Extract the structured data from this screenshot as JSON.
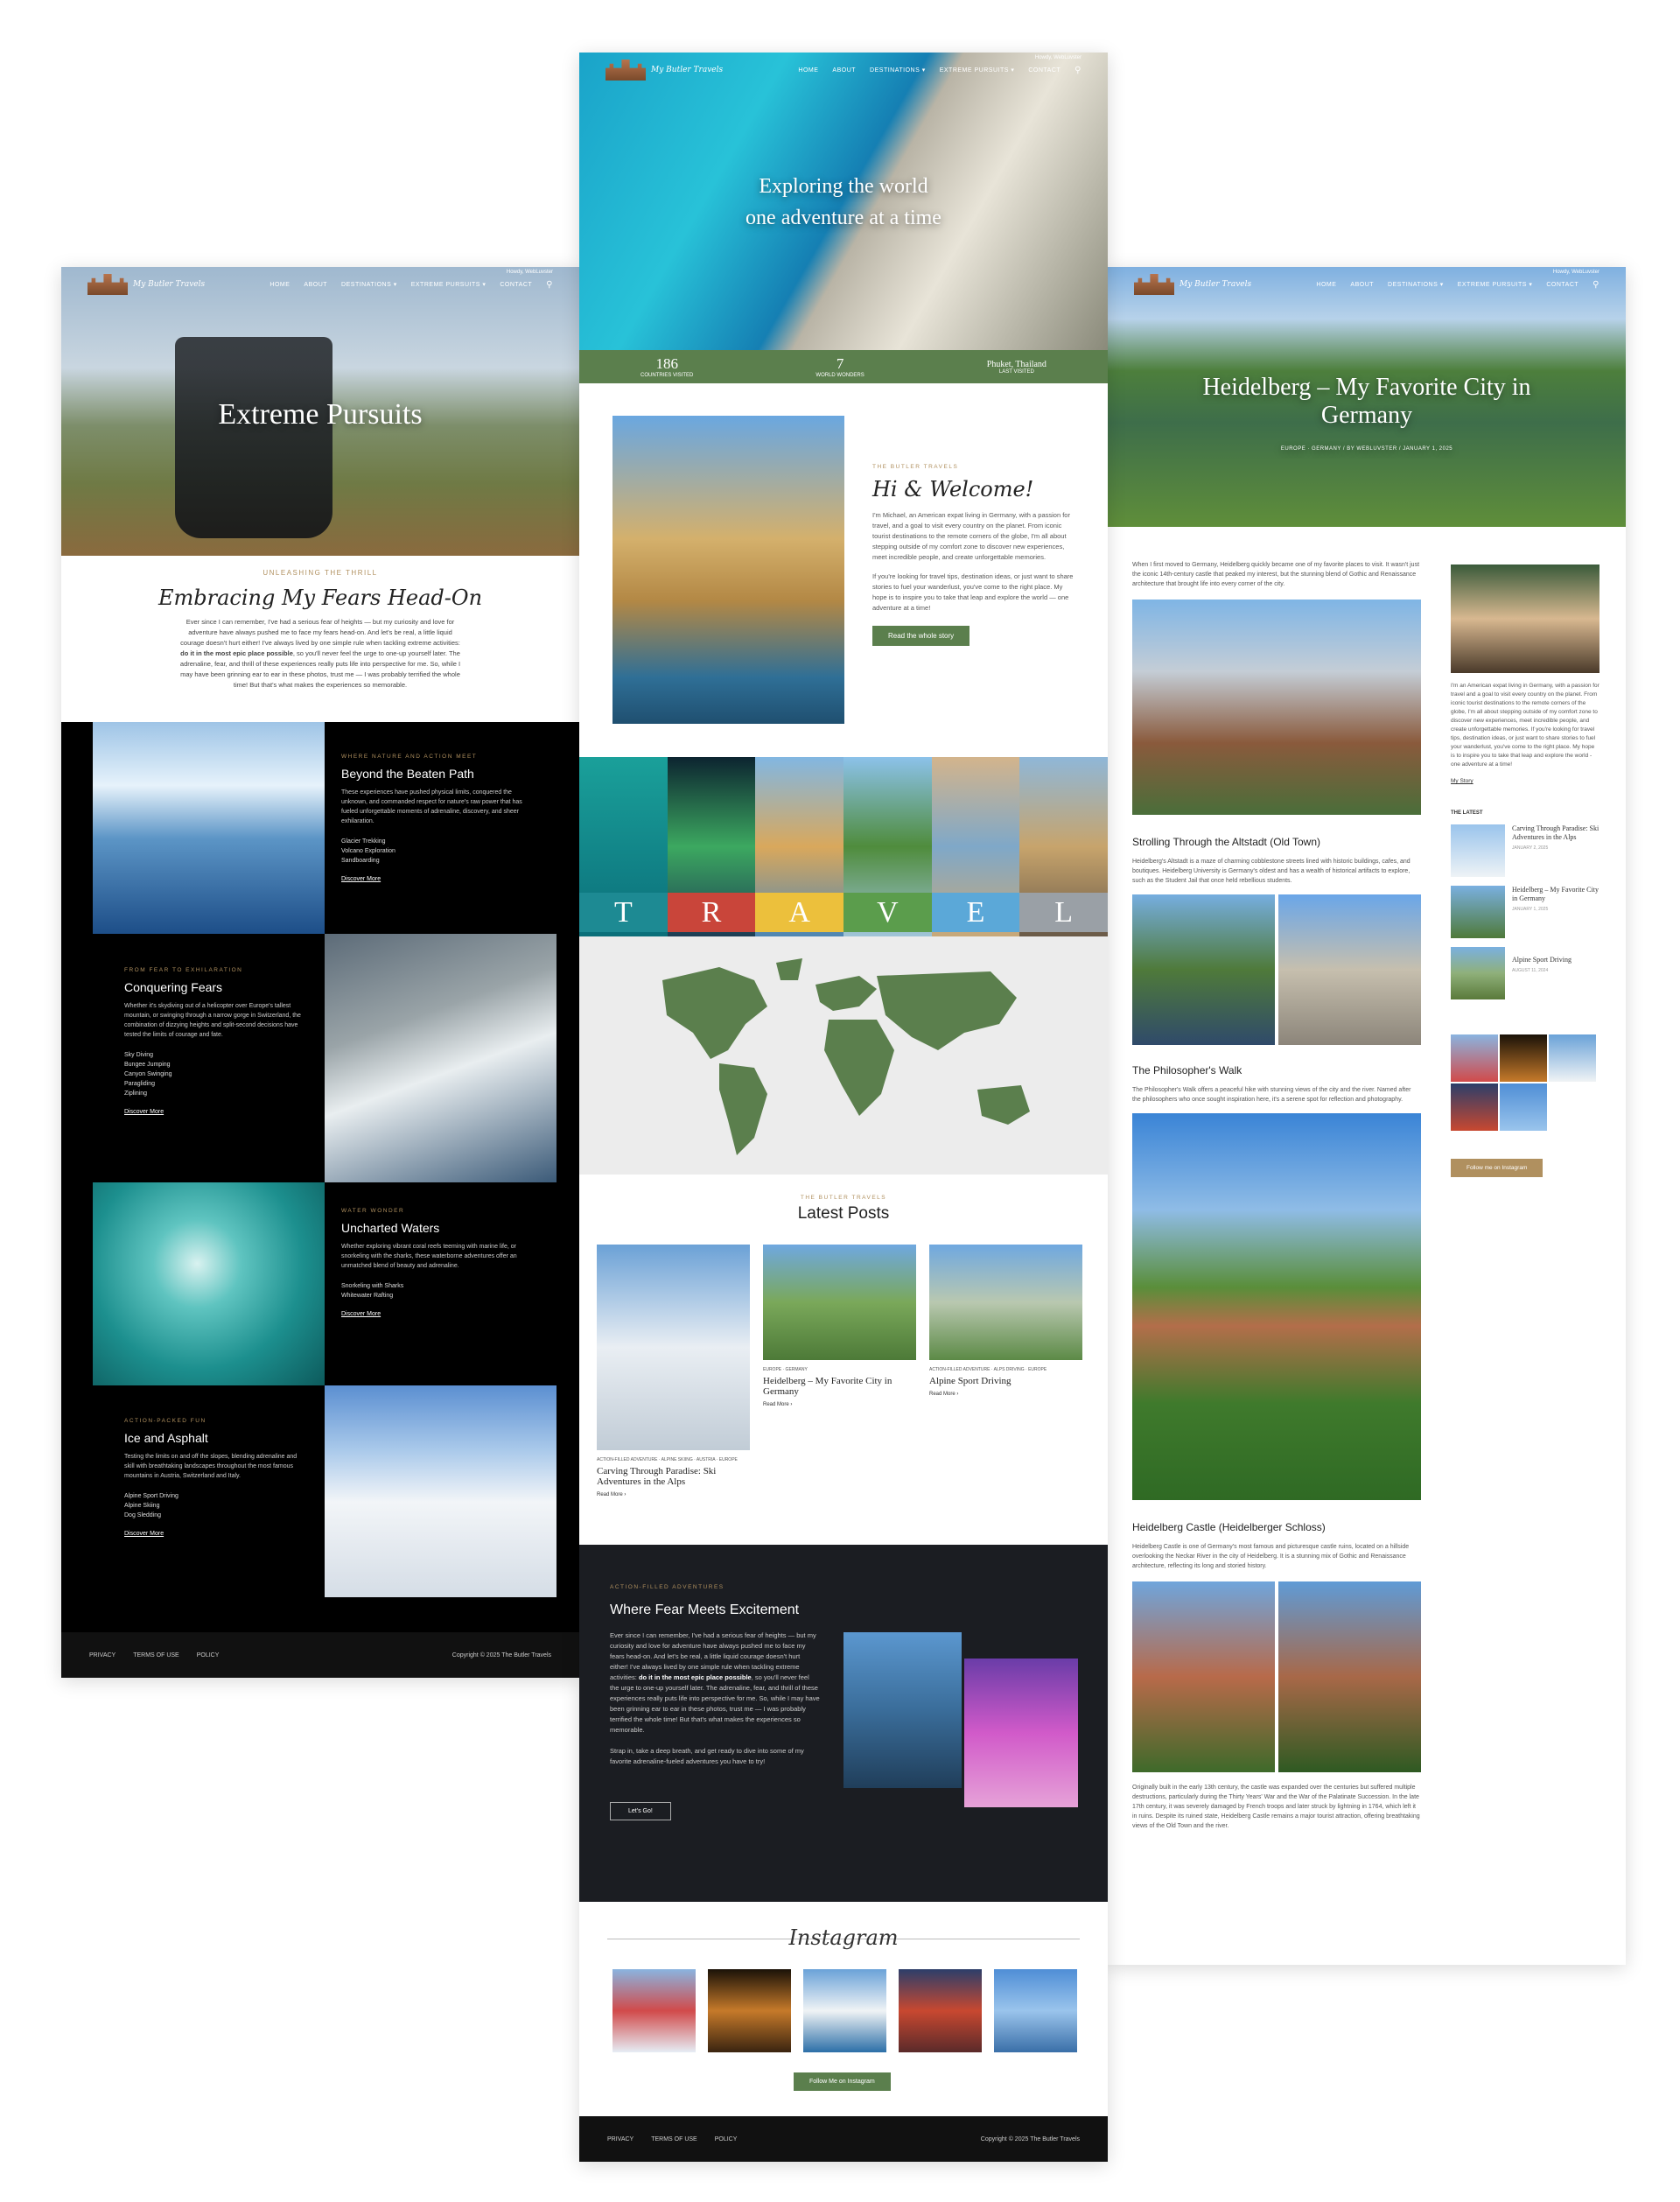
{
  "nav": {
    "logo": "My Butler Travels",
    "items": [
      "HOME",
      "ABOUT",
      "DESTINATIONS ▾",
      "EXTREME PURSUITS ▾",
      "CONTACT"
    ],
    "topnote": "Howdy, WebLuvster"
  },
  "icons": {
    "search": "search-icon"
  },
  "home": {
    "hero_line1": "Exploring the world",
    "hero_line2": "one adventure at a time",
    "stats": [
      {
        "value": "186",
        "label": "COUNTRIES VISITED"
      },
      {
        "value": "7",
        "label": "WORLD WONDERS"
      },
      {
        "value": "Phuket, Thailand",
        "label": "LAST VISITED"
      }
    ],
    "welcome_eyebrow": "THE BUTLER TRAVELS",
    "welcome_title": "Hi & Welcome!",
    "welcome_p1": "I'm Michael, an American expat living in Germany, with a passion for travel, and a goal to visit every country on the planet. From iconic tourist destinations to the remote corners of the globe, I'm all about stepping outside of my comfort zone to discover new experiences, meet incredible people, and create unforgettable memories.",
    "welcome_p2": "If you're looking for travel tips, destination ideas, or just want to share stories to fuel your wanderlust, you've come to the right place. My hope is to inspire you to take that leap and explore the world — one adventure at a time!",
    "welcome_btn": "Read the whole story",
    "travel_letters": [
      "T",
      "R",
      "A",
      "V",
      "E",
      "L"
    ],
    "latest_eyebrow": "THE BUTLER TRAVELS",
    "latest_title": "Latest Posts",
    "posts": [
      {
        "cats": "ACTION-FILLED ADVENTURE · ALPINE SKIING · AUSTRIA · EUROPE",
        "title": "Carving Through Paradise: Ski Adventures in the Alps",
        "more": "Read More ›"
      },
      {
        "cats": "EUROPE · GERMANY",
        "title": "Heidelberg – My Favorite City in Germany",
        "more": "Read More ›"
      },
      {
        "cats": "ACTION-FILLED ADVENTURE · ALPS DRIVING · EUROPE",
        "title": "Alpine Sport Driving",
        "more": "Read More ›"
      }
    ],
    "fear_eyebrow": "ACTION-FILLED ADVENTURES",
    "fear_title": "Where Fear Meets Excitement",
    "fear_p1a": "Ever since I can remember, I've had a serious fear of heights — but my curiosity and love for adventure have always pushed me to face my fears head-on. And let's be real, a little liquid courage doesn't hurt either! I've always lived by one simple rule when tackling extreme activities: ",
    "fear_p1b": "do it in the most epic place possible",
    "fear_p1c": ", so you'll never feel the urge to one-up yourself later. The adrenaline, fear, and thrill of these experiences really puts life into perspective for me. So, while I may have been grinning ear to ear in these photos, trust me — I was probably terrified the whole time! But that's what makes the experiences so memorable.",
    "fear_p2": "Strap in, take a deep breath, and get ready to dive into some of my favorite adrenaline-fueled adventures you have to try!",
    "fear_btn": "Let's Go!",
    "insta_title": "Instagram",
    "insta_btn": "Follow Me on Instagram"
  },
  "footer": {
    "links": [
      "PRIVACY",
      "TERMS OF USE",
      "POLICY"
    ],
    "copyright": "Copyright © 2025 The Butler Travels"
  },
  "extreme": {
    "hero_title": "Extreme Pursuits",
    "eyebrow": "UNLEASHING THE THRILL",
    "title": "Embracing My Fears Head-On",
    "intro_a": "Ever since I can remember, I've had a serious fear of heights — but my curiosity and love for adventure have always pushed me to face my fears head-on. And let's be real, a little liquid courage doesn't hurt either! I've always lived by one simple rule when tackling extreme activities: ",
    "intro_b": "do it in the most epic place possible",
    "intro_c": ", so you'll never feel the urge to one-up yourself later. The adrenaline, fear, and thrill of these experiences really puts life into perspective for me. So, while I may have been grinning ear to ear in these photos, trust me — I was probably terrified the whole time! But that's what makes the experiences so memorable.",
    "blocks": [
      {
        "eyebrow": "WHERE NATURE AND ACTION MEET",
        "title": "Beyond the Beaten Path",
        "text": "These experiences have pushed physical limits, conquered the unknown, and commanded respect for nature's raw power that has fueled unforgettable moments of adrenaline, discovery, and sheer exhilaration.",
        "list": [
          "Glacier Trekking",
          "Volcano Exploration",
          "Sandboarding"
        ],
        "more": "Discover More"
      },
      {
        "eyebrow": "FROM FEAR TO EXHILARATION",
        "title": "Conquering Fears",
        "text": "Whether it's skydiving out of a helicopter over Europe's tallest mountain, or swinging through a narrow gorge in Switzerland, the combination of dizzying heights and split-second decisions have tested the limits of courage and fate.",
        "list": [
          "Sky Diving",
          "Bungee Jumping",
          "Canyon Swinging",
          "Paragliding",
          "Ziplining"
        ],
        "more": "Discover More"
      },
      {
        "eyebrow": "WATER WONDER",
        "title": "Uncharted Waters",
        "text": "Whether exploring vibrant coral reefs teeming with marine life, or snorkeling with the sharks, these waterborne adventures offer an unmatched blend of beauty and adrenaline.",
        "list": [
          "Snorkeling with Sharks",
          "Whitewater Rafting"
        ],
        "more": "Discover More"
      },
      {
        "eyebrow": "ACTION-PACKED FUN",
        "title": "Ice and Asphalt",
        "text": "Testing the limits on and off the slopes, blending adrenaline and skill with breathtaking landscapes throughout the most famous mountains in Austria, Switzerland and Italy.",
        "list": [
          "Alpine Sport Driving",
          "Alpine Skiing",
          "Dog Sledding"
        ],
        "more": "Discover More"
      }
    ]
  },
  "heidelberg": {
    "hero_title": "Heidelberg – My Favorite City in Germany",
    "meta": "EUROPE · GERMANY / BY WEBLUVSTER / JANUARY 1, 2025",
    "intro": "When I first moved to Germany, Heidelberg quickly became one of my favorite places to visit. It wasn't just the iconic 14th-century castle that peaked my interest, but the stunning blend of Gothic and Renaissance architecture that brought life into every corner of the city.",
    "h1": "Strolling Through the Altstadt (Old Town)",
    "p1": "Heidelberg's Altstadt is a maze of charming cobblestone streets lined with historic buildings, cafes, and boutiques. Heidelberg University is Germany's oldest and has a wealth of historical artifacts to explore, such as the Student Jail that once held rebellious students.",
    "h2": "The Philosopher's Walk",
    "p2": "The Philosopher's Walk offers a peaceful hike with stunning views of the city and the river. Named after the philosophers who once sought inspiration here, it's a serene spot for reflection and photography.",
    "h3": "Heidelberg Castle (Heidelberger Schloss)",
    "p3": "Heidelberg Castle is one of Germany's most famous and picturesque castle ruins, located on a hillside overlooking the Neckar River in the city of Heidelberg. It is a stunning mix of Gothic and Renaissance architecture, reflecting its long and storied history.",
    "p4": "Originally built in the early 13th century, the castle was expanded over the centuries but suffered multiple destructions, particularly during the Thirty Years' War and the War of the Palatinate Succession. In the late 17th century, it was severely damaged by French troops and later struck by lightning in 1764, which left it in ruins. Despite its ruined state, Heidelberg Castle remains a major tourist attraction, offering breathtaking views of the Old Town and the river.",
    "side_bio": "I'm an American expat living in Germany, with a passion for travel and a goal to visit every country on the planet. From iconic tourist destinations to the remote corners of the globe, I'm all about stepping outside of my comfort zone to discover new experiences, meet incredible people, and create unforgettable memories. If you're looking for travel tips, destination ideas, or just want to share stories to fuel your wanderlust, you've come to the right place. My hope is to inspire you to take that leap and explore the world - one adventure at a time!",
    "side_story": "My Story",
    "side_latest": "THE LATEST",
    "side_posts": [
      {
        "title": "Carving Through Paradise: Ski Adventures in the Alps",
        "date": "JANUARY 2, 2025"
      },
      {
        "title": "Heidelberg – My Favorite City in Germany",
        "date": "JANUARY 1, 2025"
      },
      {
        "title": "Alpine Sport Driving",
        "date": "AUGUST 11, 2024"
      }
    ],
    "side_btn": "Follow me on Instagram"
  },
  "colors": {
    "green": "#5b7f4d",
    "gold": "#b0905f",
    "dark": "#111111"
  }
}
